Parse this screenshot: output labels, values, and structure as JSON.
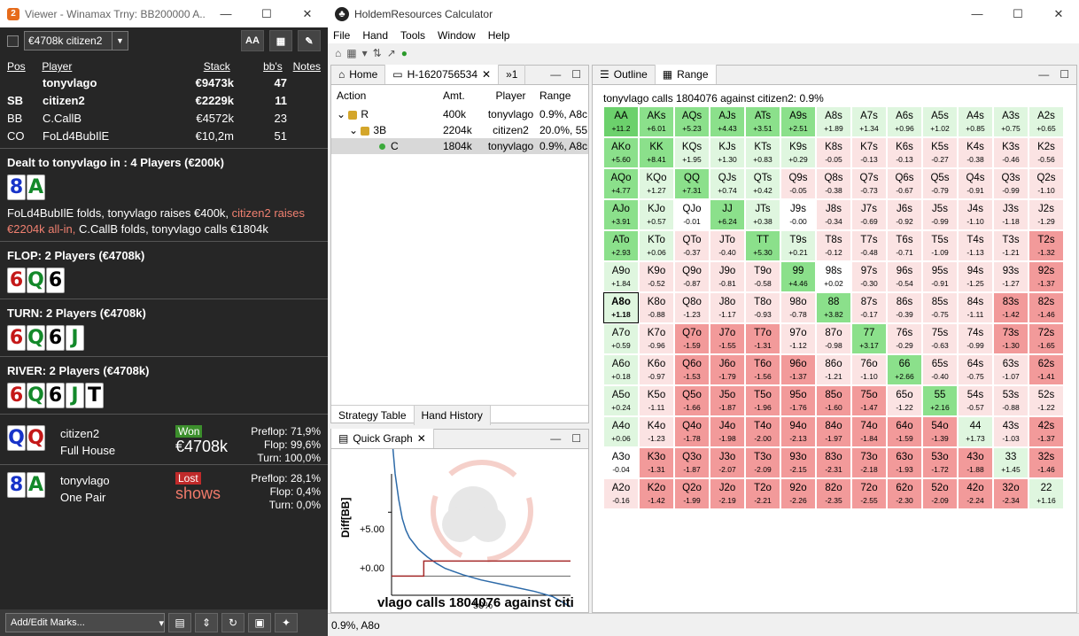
{
  "viewer": {
    "title": "Viewer - Winamax Trny: BB200000 A...",
    "min": "—",
    "max": "☐",
    "close": "✕",
    "combo_value": "€4708k citizen2",
    "btn_aa": "AA",
    "btn_grid": "▦",
    "btn_edit": "✎",
    "headers": {
      "pos": "Pos",
      "player": "Player",
      "stack": "Stack",
      "bbs": "bb's",
      "notes": "Notes"
    },
    "players": [
      {
        "pos": "",
        "name": "tonyvlago",
        "stack": "€9473k",
        "bbs": "47"
      },
      {
        "pos": "SB",
        "name": "citizen2",
        "stack": "€2229k",
        "bbs": "11"
      },
      {
        "pos": "BB",
        "name": "C.CallB",
        "stack": "€4572k",
        "bbs": "23"
      },
      {
        "pos": "CO",
        "name": "FoLd4BubIlE",
        "stack": "€10,2m",
        "bbs": "51"
      }
    ],
    "preflop_title": "Dealt to tonyvlago in : 4 Players (€200k)",
    "hole": [
      "8",
      "A"
    ],
    "preflop_action_1": "FoLd4BubIlE folds, tonyvlago raises €400k, ",
    "preflop_action_red": "citizen2 raises €2204k all-in,",
    "preflop_action_2": " C.CallB folds, tonyvlago calls €1804k",
    "flop_title": "FLOP: 2 Players (€4708k)",
    "flop": [
      "6",
      "Q",
      "6"
    ],
    "turn_title": "TURN: 2 Players (€4708k)",
    "turn": [
      "6",
      "Q",
      "6",
      "J"
    ],
    "river_title": "RIVER: 2 Players (€4708k)",
    "river": [
      "6",
      "Q",
      "6",
      "J",
      "T"
    ],
    "r1": {
      "cards": [
        "Q",
        "Q"
      ],
      "name": "citizen2",
      "hand": "Full House",
      "badge": "Won",
      "amount": "€4708k",
      "pre": "Preflop: 71,9%",
      "flop": "Flop: 99,6%",
      "turn": "Turn: 100,0%"
    },
    "r2": {
      "cards": [
        "8",
        "A"
      ],
      "name": "tonyvlago",
      "hand": "One Pair",
      "badge": "Lost",
      "amount": "shows",
      "pre": "Preflop: 28,1%",
      "flop": "Flop: 0,4%",
      "turn": "Turn: 0,0%"
    },
    "marks": "Add/Edit Marks...",
    "marks_arrow": "▾"
  },
  "hr": {
    "title": "HoldemResources Calculator",
    "min": "—",
    "max": "☐",
    "close": "✕",
    "menu": [
      "File",
      "Hand",
      "Tools",
      "Window",
      "Help"
    ],
    "tab_home": "Home",
    "tab_hand": "H-1620756534",
    "tab_more": "»1",
    "tree_headers": {
      "action": "Action",
      "amt": "Amt.",
      "player": "Player",
      "range": "Range"
    },
    "tree_rows": [
      {
        "action": "R",
        "amt": "400k",
        "player": "tonyvlago",
        "range": "0.9%, A8c"
      },
      {
        "action": "3B",
        "amt": "2204k",
        "player": "citizen2",
        "range": "20.0%, 55"
      },
      {
        "action": "C",
        "amt": "1804k",
        "player": "tonyvlago",
        "range": "0.9%, A8c"
      }
    ],
    "bottom_tabs": [
      "Strategy Table",
      "Hand History"
    ],
    "qg_title": "Quick Graph",
    "qg_ylabel": "Diff[BB]",
    "qg_y1": "+5.00",
    "qg_y0": "+0.00",
    "qg_x50": "50%",
    "qg_caption": "vlago calls 1804076 against citi",
    "outline_tab": "Outline",
    "range_tab": "Range",
    "range_header": "tonyvlago calls 1804076 against citizen2: 0.9%",
    "status": "0.9%, A8o",
    "colors": {
      "pos_strong": "#8be08b",
      "pos_weak": "#dff6df",
      "neg_weak": "#fbe3e3",
      "neg_strong": "#f29a9a"
    }
  },
  "chart_data": {
    "type": "line",
    "title": "vlago calls 1804076 against citi",
    "ylabel": "Diff[BB]",
    "xlabel": "",
    "ylim": [
      -1.5,
      8
    ],
    "y_ticks": [
      "+0.00",
      "+5.00"
    ],
    "x_ticks": [
      "50%"
    ],
    "series": [
      {
        "x": [
          0,
          2,
          4,
          6,
          8,
          10,
          15,
          20,
          25,
          30,
          40,
          50,
          60,
          70,
          80,
          90,
          100
        ],
        "values": [
          11.2,
          8,
          6,
          4.5,
          3.6,
          3,
          2.1,
          1.5,
          1,
          0.6,
          0.1,
          -0.3,
          -0.6,
          -0.9,
          -1.2,
          -1.6,
          -2.4
        ]
      },
      {
        "x": [
          0,
          18,
          18,
          20,
          100
        ],
        "values": [
          0,
          0,
          1.18,
          1.18,
          1.18
        ]
      }
    ]
  },
  "range": [
    [
      {
        "h": "AA",
        "v": "+11.2",
        "ev": 11.2
      },
      {
        "h": "AKs",
        "v": "+6.01",
        "ev": 6.01
      },
      {
        "h": "AQs",
        "v": "+5.23",
        "ev": 5.23
      },
      {
        "h": "AJs",
        "v": "+4.43",
        "ev": 4.43
      },
      {
        "h": "ATs",
        "v": "+3.51",
        "ev": 3.51
      },
      {
        "h": "A9s",
        "v": "+2.51",
        "ev": 2.51
      },
      {
        "h": "A8s",
        "v": "+1.89",
        "ev": 1.89
      },
      {
        "h": "A7s",
        "v": "+1.34",
        "ev": 1.34
      },
      {
        "h": "A6s",
        "v": "+0.96",
        "ev": 0.96
      },
      {
        "h": "A5s",
        "v": "+1.02",
        "ev": 1.02
      },
      {
        "h": "A4s",
        "v": "+0.85",
        "ev": 0.85
      },
      {
        "h": "A3s",
        "v": "+0.75",
        "ev": 0.75
      },
      {
        "h": "A2s",
        "v": "+0.65",
        "ev": 0.65
      }
    ],
    [
      {
        "h": "AKo",
        "v": "+5.60",
        "ev": 5.6
      },
      {
        "h": "KK",
        "v": "+8.41",
        "ev": 8.41
      },
      {
        "h": "KQs",
        "v": "+1.95",
        "ev": 1.95
      },
      {
        "h": "KJs",
        "v": "+1.30",
        "ev": 1.3
      },
      {
        "h": "KTs",
        "v": "+0.83",
        "ev": 0.83
      },
      {
        "h": "K9s",
        "v": "+0.29",
        "ev": 0.29
      },
      {
        "h": "K8s",
        "v": "-0.05",
        "ev": -0.05
      },
      {
        "h": "K7s",
        "v": "-0.13",
        "ev": -0.13
      },
      {
        "h": "K6s",
        "v": "-0.13",
        "ev": -0.13
      },
      {
        "h": "K5s",
        "v": "-0.27",
        "ev": -0.27
      },
      {
        "h": "K4s",
        "v": "-0.38",
        "ev": -0.38
      },
      {
        "h": "K3s",
        "v": "-0.46",
        "ev": -0.46
      },
      {
        "h": "K2s",
        "v": "-0.56",
        "ev": -0.56
      }
    ],
    [
      {
        "h": "AQo",
        "v": "+4.77",
        "ev": 4.77
      },
      {
        "h": "KQo",
        "v": "+1.27",
        "ev": 1.27
      },
      {
        "h": "QQ",
        "v": "+7.31",
        "ev": 7.31
      },
      {
        "h": "QJs",
        "v": "+0.74",
        "ev": 0.74
      },
      {
        "h": "QTs",
        "v": "+0.42",
        "ev": 0.42
      },
      {
        "h": "Q9s",
        "v": "-0.05",
        "ev": -0.05
      },
      {
        "h": "Q8s",
        "v": "-0.38",
        "ev": -0.38
      },
      {
        "h": "Q7s",
        "v": "-0.73",
        "ev": -0.73
      },
      {
        "h": "Q6s",
        "v": "-0.67",
        "ev": -0.67
      },
      {
        "h": "Q5s",
        "v": "-0.79",
        "ev": -0.79
      },
      {
        "h": "Q4s",
        "v": "-0.91",
        "ev": -0.91
      },
      {
        "h": "Q3s",
        "v": "-0.99",
        "ev": -0.99
      },
      {
        "h": "Q2s",
        "v": "-1.10",
        "ev": -1.1
      }
    ],
    [
      {
        "h": "AJo",
        "v": "+3.91",
        "ev": 3.91
      },
      {
        "h": "KJo",
        "v": "+0.57",
        "ev": 0.57
      },
      {
        "h": "QJo",
        "v": "-0.01",
        "ev": -0.01
      },
      {
        "h": "JJ",
        "v": "+6.24",
        "ev": 6.24
      },
      {
        "h": "JTs",
        "v": "+0.38",
        "ev": 0.38
      },
      {
        "h": "J9s",
        "v": "-0.00",
        "ev": 0
      },
      {
        "h": "J8s",
        "v": "-0.34",
        "ev": -0.34
      },
      {
        "h": "J7s",
        "v": "-0.69",
        "ev": -0.69
      },
      {
        "h": "J6s",
        "v": "-0.92",
        "ev": -0.92
      },
      {
        "h": "J5s",
        "v": "-0.99",
        "ev": -0.99
      },
      {
        "h": "J4s",
        "v": "-1.10",
        "ev": -1.1
      },
      {
        "h": "J3s",
        "v": "-1.18",
        "ev": -1.18
      },
      {
        "h": "J2s",
        "v": "-1.29",
        "ev": -1.29
      }
    ],
    [
      {
        "h": "ATo",
        "v": "+2.93",
        "ev": 2.93
      },
      {
        "h": "KTo",
        "v": "+0.06",
        "ev": 0.06
      },
      {
        "h": "QTo",
        "v": "-0.37",
        "ev": -0.37
      },
      {
        "h": "JTo",
        "v": "-0.40",
        "ev": -0.4
      },
      {
        "h": "TT",
        "v": "+5.30",
        "ev": 5.3
      },
      {
        "h": "T9s",
        "v": "+0.21",
        "ev": 0.21
      },
      {
        "h": "T8s",
        "v": "-0.12",
        "ev": -0.12
      },
      {
        "h": "T7s",
        "v": "-0.48",
        "ev": -0.48
      },
      {
        "h": "T6s",
        "v": "-0.71",
        "ev": -0.71
      },
      {
        "h": "T5s",
        "v": "-1.09",
        "ev": -1.09
      },
      {
        "h": "T4s",
        "v": "-1.13",
        "ev": -1.13
      },
      {
        "h": "T3s",
        "v": "-1.21",
        "ev": -1.21
      },
      {
        "h": "T2s",
        "v": "-1.32",
        "ev": -1.32
      }
    ],
    [
      {
        "h": "A9o",
        "v": "+1.84",
        "ev": 1.84
      },
      {
        "h": "K9o",
        "v": "-0.52",
        "ev": -0.52
      },
      {
        "h": "Q9o",
        "v": "-0.87",
        "ev": -0.87
      },
      {
        "h": "J9o",
        "v": "-0.81",
        "ev": -0.81
      },
      {
        "h": "T9o",
        "v": "-0.58",
        "ev": -0.58
      },
      {
        "h": "99",
        "v": "+4.46",
        "ev": 4.46
      },
      {
        "h": "98s",
        "v": "+0.02",
        "ev": 0.02
      },
      {
        "h": "97s",
        "v": "-0.30",
        "ev": -0.3
      },
      {
        "h": "96s",
        "v": "-0.54",
        "ev": -0.54
      },
      {
        "h": "95s",
        "v": "-0.91",
        "ev": -0.91
      },
      {
        "h": "94s",
        "v": "-1.25",
        "ev": -1.25
      },
      {
        "h": "93s",
        "v": "-1.27",
        "ev": -1.27
      },
      {
        "h": "92s",
        "v": "-1.37",
        "ev": -1.37
      }
    ],
    [
      {
        "h": "A8o",
        "v": "+1.18",
        "ev": 1.18,
        "hl": true
      },
      {
        "h": "K8o",
        "v": "-0.88",
        "ev": -0.88
      },
      {
        "h": "Q8o",
        "v": "-1.23",
        "ev": -1.23
      },
      {
        "h": "J8o",
        "v": "-1.17",
        "ev": -1.17
      },
      {
        "h": "T8o",
        "v": "-0.93",
        "ev": -0.93
      },
      {
        "h": "98o",
        "v": "-0.78",
        "ev": -0.78
      },
      {
        "h": "88",
        "v": "+3.82",
        "ev": 3.82
      },
      {
        "h": "87s",
        "v": "-0.17",
        "ev": -0.17
      },
      {
        "h": "86s",
        "v": "-0.39",
        "ev": -0.39
      },
      {
        "h": "85s",
        "v": "-0.75",
        "ev": -0.75
      },
      {
        "h": "84s",
        "v": "-1.11",
        "ev": -1.11
      },
      {
        "h": "83s",
        "v": "-1.42",
        "ev": -1.42
      },
      {
        "h": "82s",
        "v": "-1.46",
        "ev": -1.46
      }
    ],
    [
      {
        "h": "A7o",
        "v": "+0.59",
        "ev": 0.59
      },
      {
        "h": "K7o",
        "v": "-0.96",
        "ev": -0.96
      },
      {
        "h": "Q7o",
        "v": "-1.59",
        "ev": -1.59
      },
      {
        "h": "J7o",
        "v": "-1.55",
        "ev": -1.55
      },
      {
        "h": "T7o",
        "v": "-1.31",
        "ev": -1.31
      },
      {
        "h": "97o",
        "v": "-1.12",
        "ev": -1.12
      },
      {
        "h": "87o",
        "v": "-0.98",
        "ev": -0.98
      },
      {
        "h": "77",
        "v": "+3.17",
        "ev": 3.17
      },
      {
        "h": "76s",
        "v": "-0.29",
        "ev": -0.29
      },
      {
        "h": "75s",
        "v": "-0.63",
        "ev": -0.63
      },
      {
        "h": "74s",
        "v": "-0.99",
        "ev": -0.99
      },
      {
        "h": "73s",
        "v": "-1.30",
        "ev": -1.3
      },
      {
        "h": "72s",
        "v": "-1.65",
        "ev": -1.65
      }
    ],
    [
      {
        "h": "A6o",
        "v": "+0.18",
        "ev": 0.18
      },
      {
        "h": "K6o",
        "v": "-0.97",
        "ev": -0.97
      },
      {
        "h": "Q6o",
        "v": "-1.53",
        "ev": -1.53
      },
      {
        "h": "J6o",
        "v": "-1.79",
        "ev": -1.79
      },
      {
        "h": "T6o",
        "v": "-1.56",
        "ev": -1.56
      },
      {
        "h": "96o",
        "v": "-1.37",
        "ev": -1.37
      },
      {
        "h": "86o",
        "v": "-1.21",
        "ev": -1.21
      },
      {
        "h": "76o",
        "v": "-1.10",
        "ev": -1.1
      },
      {
        "h": "66",
        "v": "+2.66",
        "ev": 2.66
      },
      {
        "h": "65s",
        "v": "-0.40",
        "ev": -0.4
      },
      {
        "h": "64s",
        "v": "-0.75",
        "ev": -0.75
      },
      {
        "h": "63s",
        "v": "-1.07",
        "ev": -1.07
      },
      {
        "h": "62s",
        "v": "-1.41",
        "ev": -1.41
      }
    ],
    [
      {
        "h": "A5o",
        "v": "+0.24",
        "ev": 0.24
      },
      {
        "h": "K5o",
        "v": "-1.11",
        "ev": -1.11
      },
      {
        "h": "Q5o",
        "v": "-1.66",
        "ev": -1.66
      },
      {
        "h": "J5o",
        "v": "-1.87",
        "ev": -1.87
      },
      {
        "h": "T5o",
        "v": "-1.96",
        "ev": -1.96
      },
      {
        "h": "95o",
        "v": "-1.76",
        "ev": -1.76
      },
      {
        "h": "85o",
        "v": "-1.60",
        "ev": -1.6
      },
      {
        "h": "75o",
        "v": "-1.47",
        "ev": -1.47
      },
      {
        "h": "65o",
        "v": "-1.22",
        "ev": -1.22
      },
      {
        "h": "55",
        "v": "+2.16",
        "ev": 2.16
      },
      {
        "h": "54s",
        "v": "-0.57",
        "ev": -0.57
      },
      {
        "h": "53s",
        "v": "-0.88",
        "ev": -0.88
      },
      {
        "h": "52s",
        "v": "-1.22",
        "ev": -1.22
      }
    ],
    [
      {
        "h": "A4o",
        "v": "+0.06",
        "ev": 0.06
      },
      {
        "h": "K4o",
        "v": "-1.23",
        "ev": -1.23
      },
      {
        "h": "Q4o",
        "v": "-1.78",
        "ev": -1.78
      },
      {
        "h": "J4o",
        "v": "-1.98",
        "ev": -1.98
      },
      {
        "h": "T4o",
        "v": "-2.00",
        "ev": -2
      },
      {
        "h": "94o",
        "v": "-2.13",
        "ev": -2.13
      },
      {
        "h": "84o",
        "v": "-1.97",
        "ev": -1.97
      },
      {
        "h": "74o",
        "v": "-1.84",
        "ev": -1.84
      },
      {
        "h": "64o",
        "v": "-1.59",
        "ev": -1.59
      },
      {
        "h": "54o",
        "v": "-1.39",
        "ev": -1.39
      },
      {
        "h": "44",
        "v": "+1.73",
        "ev": 1.73
      },
      {
        "h": "43s",
        "v": "-1.03",
        "ev": -1.03
      },
      {
        "h": "42s",
        "v": "-1.37",
        "ev": -1.37
      }
    ],
    [
      {
        "h": "A3o",
        "v": "-0.04",
        "ev": -0.04
      },
      {
        "h": "K3o",
        "v": "-1.31",
        "ev": -1.31
      },
      {
        "h": "Q3o",
        "v": "-1.87",
        "ev": -1.87
      },
      {
        "h": "J3o",
        "v": "-2.07",
        "ev": -2.07
      },
      {
        "h": "T3o",
        "v": "-2.09",
        "ev": -2.09
      },
      {
        "h": "93o",
        "v": "-2.15",
        "ev": -2.15
      },
      {
        "h": "83o",
        "v": "-2.31",
        "ev": -2.31
      },
      {
        "h": "73o",
        "v": "-2.18",
        "ev": -2.18
      },
      {
        "h": "63o",
        "v": "-1.93",
        "ev": -1.93
      },
      {
        "h": "53o",
        "v": "-1.72",
        "ev": -1.72
      },
      {
        "h": "43o",
        "v": "-1.88",
        "ev": -1.88
      },
      {
        "h": "33",
        "v": "+1.45",
        "ev": 1.45
      },
      {
        "h": "32s",
        "v": "-1.46",
        "ev": -1.46
      }
    ],
    [
      {
        "h": "A2o",
        "v": "-0.16",
        "ev": -0.16
      },
      {
        "h": "K2o",
        "v": "-1.42",
        "ev": -1.42
      },
      {
        "h": "Q2o",
        "v": "-1.99",
        "ev": -1.99
      },
      {
        "h": "J2o",
        "v": "-2.19",
        "ev": -2.19
      },
      {
        "h": "T2o",
        "v": "-2.21",
        "ev": -2.21
      },
      {
        "h": "92o",
        "v": "-2.26",
        "ev": -2.26
      },
      {
        "h": "82o",
        "v": "-2.35",
        "ev": -2.35
      },
      {
        "h": "72o",
        "v": "-2.55",
        "ev": -2.55
      },
      {
        "h": "62o",
        "v": "-2.30",
        "ev": -2.3
      },
      {
        "h": "52o",
        "v": "-2.09",
        "ev": -2.09
      },
      {
        "h": "42o",
        "v": "-2.24",
        "ev": -2.24
      },
      {
        "h": "32o",
        "v": "-2.34",
        "ev": -2.34
      },
      {
        "h": "22",
        "v": "+1.16",
        "ev": 1.16
      }
    ]
  ]
}
